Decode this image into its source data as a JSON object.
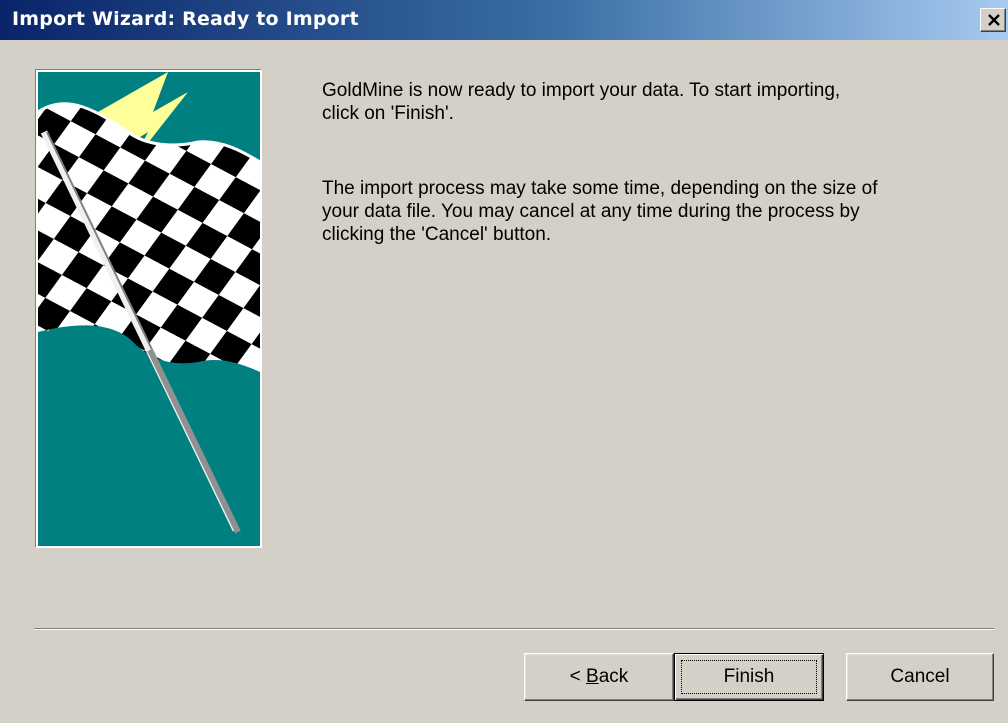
{
  "window": {
    "title": "Import Wizard: Ready to Import"
  },
  "content": {
    "paragraph1": "GoldMine is now ready to import your data.  To start importing,\nclick on 'Finish'.",
    "paragraph2": "The import process may take some time, depending on the size of\nyour data file.  You may cancel at any time during the process by\nclicking the 'Cancel' button."
  },
  "buttons": {
    "back_prefix": "< ",
    "back_mnemonic": "B",
    "back_rest": "ack",
    "finish": "Finish",
    "cancel": "Cancel"
  },
  "image": {
    "name": "checkered-flag",
    "background": "#008080",
    "accent": "#ffff99"
  },
  "colors": {
    "titlebar_start": "#0a246a",
    "titlebar_end": "#a6caf0",
    "face": "#d4d0c8"
  }
}
